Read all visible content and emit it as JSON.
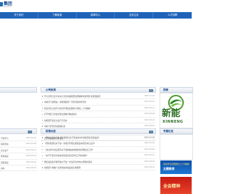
{
  "header": {
    "logo_text": "集团",
    "logo_sub": "NG GROUP"
  },
  "nav": {
    "items": [
      "关于我们",
      "了解新能",
      "新闻中心",
      "业务主页",
      "人才招聘"
    ]
  },
  "public_notice": {
    "title": "公司新闻",
    "more": "»",
    "items": [
      {
        "text": "学习贯彻习近平总书记考察新疆重要讲话精神专题党课 新能源集团",
        "date": "2023-11-20"
      },
      {
        "text": "中秋佳节送祝福，新能源集团一行慰问退休老同志",
        "date": "2023-10-07"
      },
      {
        "text": "党员同志认真学习新时代党建总要求与党的二十大精神",
        "date": "2023-09-21"
      },
      {
        "text": "召开党建工作会议暨主题教育推进会议",
        "date": "2023-09-08"
      },
      {
        "text": "新能源开展安全生产月活动",
        "date": "2023-08-23"
      },
      {
        "text": "中秋节慰问活动圆满结束",
        "date": "2023-08-10"
      },
      {
        "text": "举办主题教育读书班",
        "date": "2023-07-25"
      },
      {
        "text": "召开季度经营分析会议",
        "date": "2023-07-03"
      }
    ]
  },
  "side_news": {
    "title": "视频",
    "brand_cn": "新能",
    "brand_en": "XINNENG"
  },
  "policy": {
    "title": "政策动态",
    "more": "»",
    "items": [
      {
        "text": "《国家发展改革委 国家能源局关于促进新时代新能源高质量发展》",
        "date": "2023-11-02"
      },
      {
        "text": "《国家能源局关于进一步规范可再生能源发电项目电力业务》",
        "date": "2023-10-18"
      },
      {
        "text": "《住房城乡建设部等关于加快推进城镇供热管网改造工作》",
        "date": "2023-09-26"
      },
      {
        "text": "《关于开展光伏发电项目建设年度评估工作的通知》",
        "date": "2023-09-12"
      },
      {
        "text": "国家发展改革委印发关于进一步完善分时电价机制的通知",
        "date": "2023-08-30"
      },
      {
        "text": "新能源汽车推广应用财政补贴政策实施细则",
        "date": "2023-08-14"
      }
    ]
  },
  "topics": {
    "title": "专题栏目",
    "topic1_line1": "深化学习贯彻党的二十大精神",
    "topic1_line2": "主题教育",
    "topic2_line": "全会精神"
  },
  "left_rows": [
    {
      "text": "干部学习",
      "date": "2023-10-12"
    },
    {
      "text": "新闻活动",
      "date": "2023-10-05"
    },
    {
      "text": "安全生产",
      "date": "2023-09-21"
    },
    {
      "text": "党风建设",
      "date": "2023-09-14"
    },
    {
      "text": "项目建设",
      "date": "2023-09-01"
    },
    {
      "text": "动态",
      "date": "2023-08-25"
    }
  ]
}
